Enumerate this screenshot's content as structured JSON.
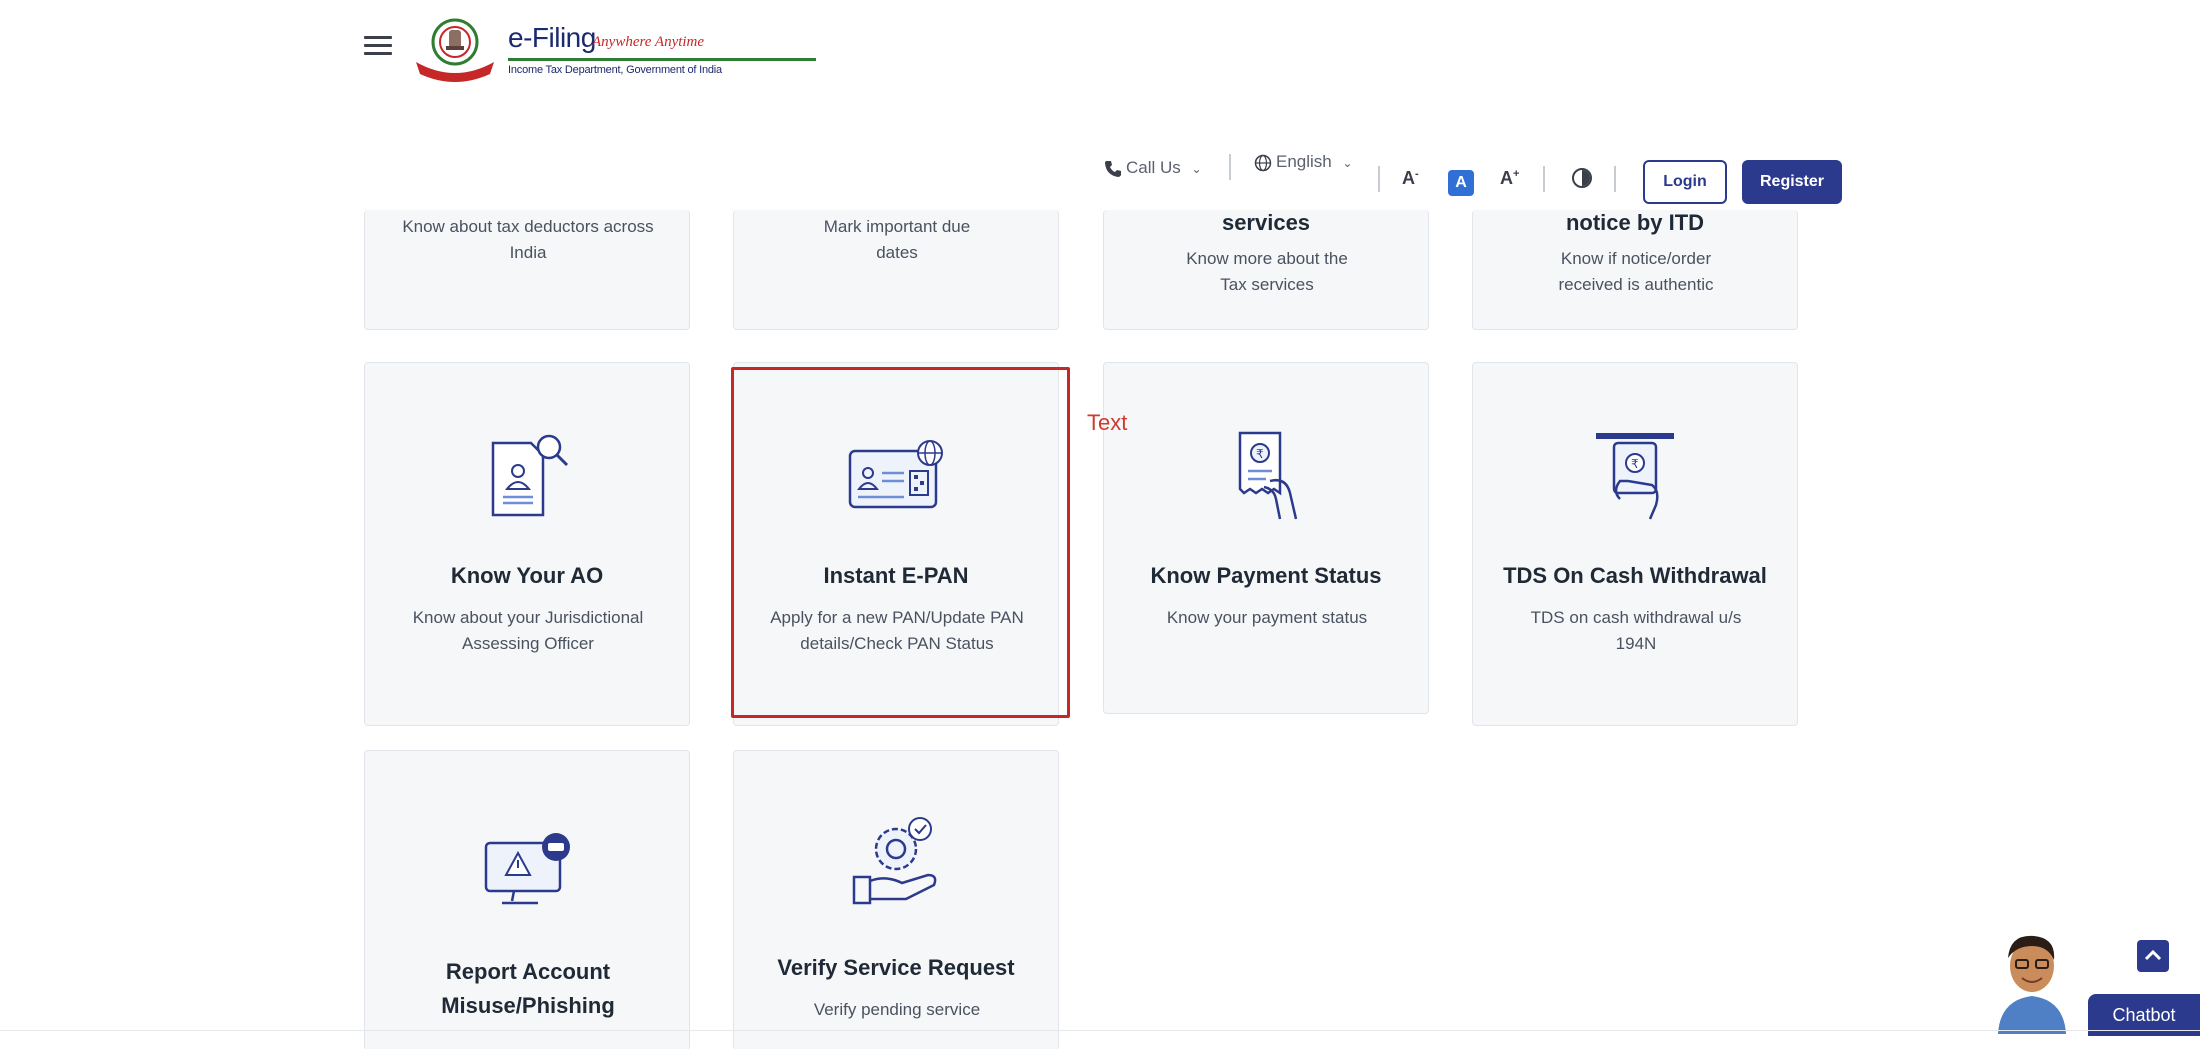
{
  "header": {
    "logo_title": "e-Filing",
    "logo_tagline": "Anywhere Anytime",
    "logo_subtitle": "Income Tax Department, Government of India"
  },
  "utility_bar": {
    "call_us": "Call Us",
    "language": "English",
    "font_decrease": "A",
    "font_default": "A",
    "font_increase": "A",
    "login": "Login",
    "register": "Register"
  },
  "cards_top_partial": [
    {
      "title": "",
      "desc": "Know about tax deductors across India"
    },
    {
      "title": "",
      "desc": "Mark important due dates"
    },
    {
      "title": "services",
      "desc": "Know more about the Tax services"
    },
    {
      "title": "notice by ITD",
      "desc": "Know if notice/order received is authentic"
    }
  ],
  "cards_middle": [
    {
      "title": "Know Your AO",
      "desc": "Know about your Jurisdictional Assessing Officer",
      "icon": "document-search-icon"
    },
    {
      "title": "Instant E-PAN",
      "desc": "Apply for a new PAN/Update PAN details/Check PAN Status",
      "icon": "pan-card-icon"
    },
    {
      "title": "Know Payment Status",
      "desc": "Know your payment status",
      "icon": "payment-receipt-hand-icon"
    },
    {
      "title": "TDS On Cash Withdrawal",
      "desc": "TDS on cash withdrawal u/s 194N",
      "icon": "atm-withdrawal-icon"
    }
  ],
  "cards_bottom": [
    {
      "title": "Report Account Misuse/Phishing",
      "desc": "",
      "icon": "monitor-warning-icon"
    },
    {
      "title": "Verify Service Request",
      "desc": "Verify pending service",
      "icon": "gear-hand-icon"
    }
  ],
  "annotation": {
    "label": "Text",
    "color": "#d03a2e"
  },
  "chatbot": {
    "label": "Chatbot"
  },
  "colors": {
    "brand": "#2b3a8c",
    "highlight": "#c62828",
    "card_bg": "#f6f7f9"
  }
}
